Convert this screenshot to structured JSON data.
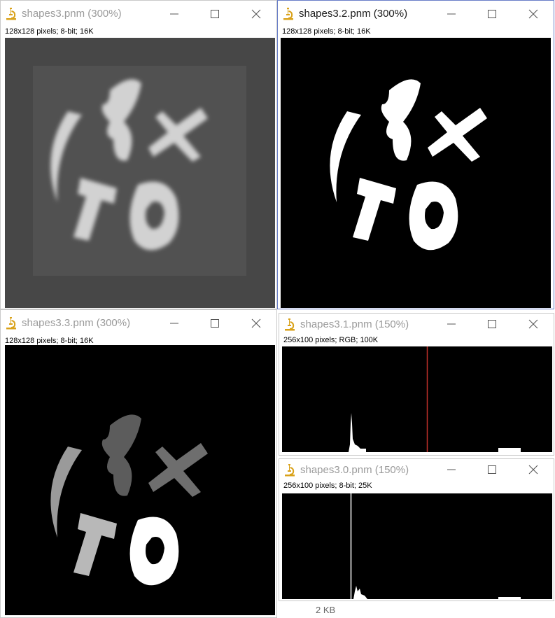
{
  "windows": [
    {
      "id": "w1",
      "title": "shapes3.pnm (300%)",
      "info": "128x128 pixels; 8-bit; 16K"
    },
    {
      "id": "w2",
      "title": "shapes3.2.pnm (300%)",
      "info": "128x128 pixels; 8-bit; 16K"
    },
    {
      "id": "w3",
      "title": "shapes3.3.pnm (300%)",
      "info": "128x128 pixels; 8-bit; 16K"
    },
    {
      "id": "w4",
      "title": "shapes3.1.pnm (150%)",
      "info": "256x100 pixels; RGB; 100K"
    },
    {
      "id": "w5",
      "title": "shapes3.0.pnm (150%)",
      "info": "256x100 pixels; 8-bit; 25K"
    }
  ],
  "behind_text": {
    "size_label": "2 KB"
  },
  "icons": {
    "app": "imagej-microscope-icon",
    "minimize": "minimize-icon",
    "maximize": "maximize-icon",
    "close": "close-icon"
  },
  "colors": {
    "title_inactive": "#9a9a9a",
    "title_active": "#1a1a1a",
    "active_border": "#6a7fc8",
    "histogram_marker": "#c0302a",
    "icon_gold": "#d9a21b"
  }
}
